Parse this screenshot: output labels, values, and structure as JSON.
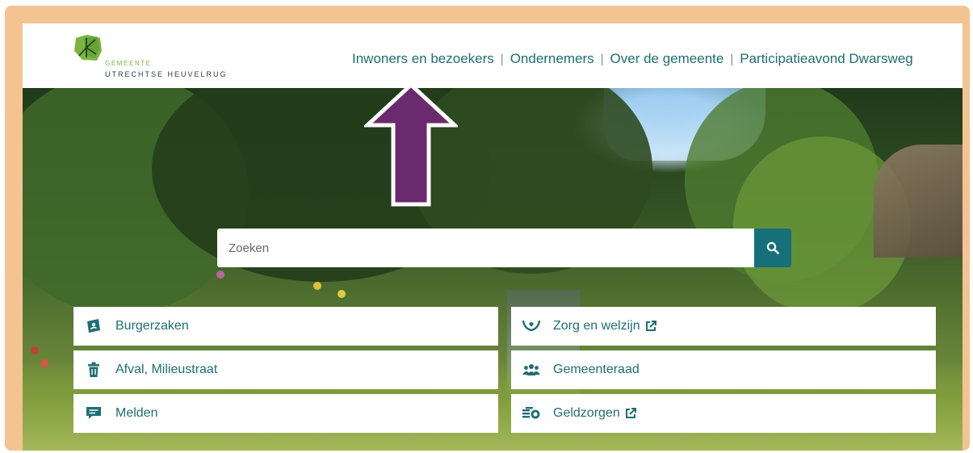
{
  "header": {
    "logo": {
      "line1": "GEMEENTE",
      "line2": "UTRECHTSE HEUVELRUG"
    },
    "nav": [
      {
        "label": "Inwoners en bezoekers"
      },
      {
        "label": "Ondernemers"
      },
      {
        "label": "Over de gemeente"
      },
      {
        "label": "Participatieavond Dwarsweg"
      }
    ],
    "separator": "|"
  },
  "search": {
    "placeholder": "Zoeken",
    "value": "",
    "icon": "search-icon"
  },
  "tiles": [
    {
      "label": "Burgerzaken",
      "icon": "id-card-icon",
      "external": false
    },
    {
      "label": "Zorg en welzijn",
      "icon": "care-hands-icon",
      "external": true
    },
    {
      "label": "Afval, Milieustraat",
      "icon": "trash-icon",
      "external": false
    },
    {
      "label": "Gemeenteraad",
      "icon": "people-group-icon",
      "external": false
    },
    {
      "label": "Melden",
      "icon": "chat-icon",
      "external": false
    },
    {
      "label": "Geldzorgen",
      "icon": "money-icon",
      "external": true
    }
  ],
  "colors": {
    "accent": "#1f6e74",
    "search_button": "#16707a",
    "frame": "#f3c491",
    "arrow": "#6b2a6d",
    "logo_green": "#7cb441"
  }
}
